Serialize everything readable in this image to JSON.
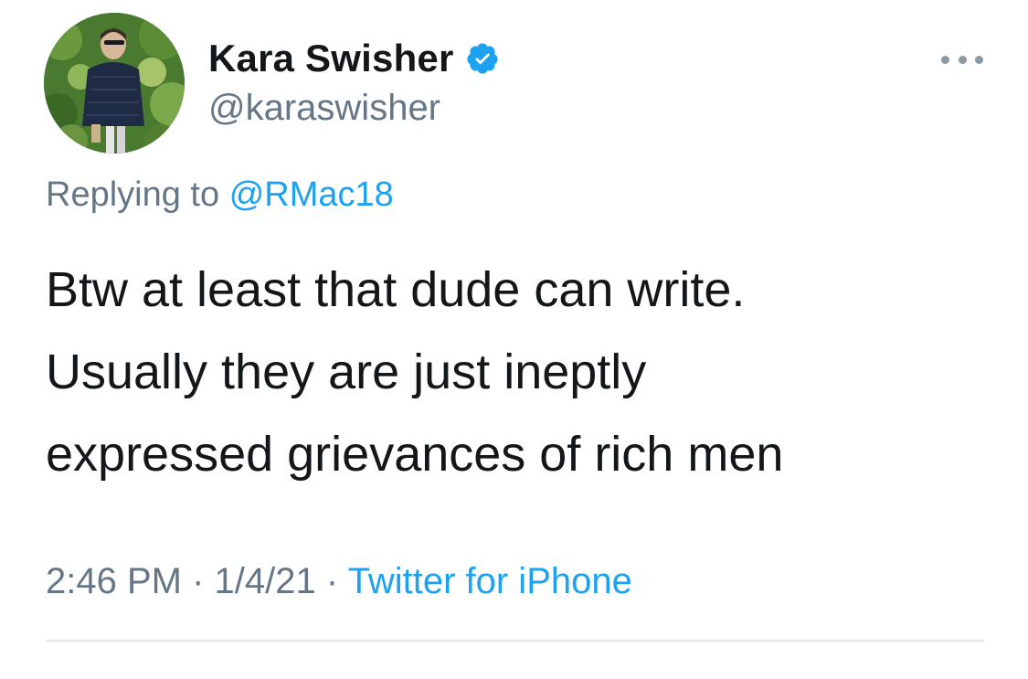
{
  "user": {
    "display_name": "Kara Swisher",
    "handle": "@karaswisher",
    "verified": true,
    "avatar_icon": "profile-photo"
  },
  "reply": {
    "prefix": "Replying to",
    "target": "@RMac18"
  },
  "tweet": {
    "lines": [
      "Btw at least that dude can write.",
      "Usually they are just ineptly",
      "expressed grievances of rich men"
    ]
  },
  "meta": {
    "time": "2:46 PM",
    "separator": "·",
    "date": "1/4/21",
    "source": "Twitter for iPhone"
  },
  "colors": {
    "accent": "#1da1f2",
    "secondary_text": "#657786",
    "primary_text": "#14171a",
    "divider": "#e1e8ed"
  },
  "icons": {
    "verified": "verified-badge-icon",
    "more": "more-options-icon"
  }
}
